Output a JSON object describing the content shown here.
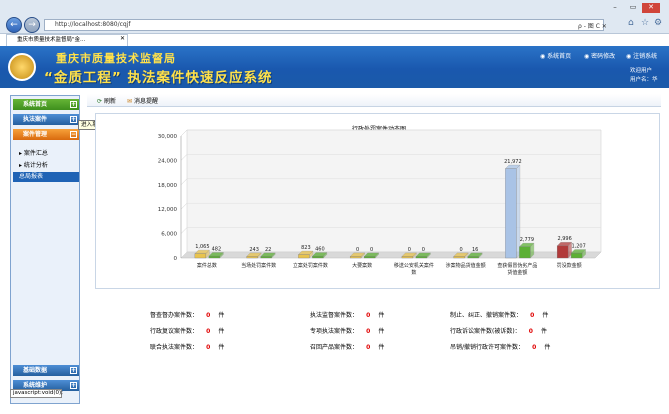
{
  "browser": {
    "back": "←",
    "forward": "→",
    "url": "http://localhost:8080/cqjf",
    "search_hint": "ρ - 图 C ✕",
    "tab_title": "重庆市质量技术监督局\"金...",
    "tab_close": "✕",
    "home": "⌂",
    "star": "☆",
    "gear": "⚙"
  },
  "header": {
    "title_line1": "重庆市质量技术监督局",
    "title_line2": "“金质工程” 执法案件快速反应系统",
    "links": [
      "系统首页",
      "密码修改",
      "注销系统"
    ],
    "welcome_line1": "欢迎用户",
    "welcome_line2": "用户名：华"
  },
  "sidebar": {
    "home": "系统首页",
    "enforce": "执法案件",
    "case_mgmt": "案件管理",
    "sub_items": [
      "案件汇总",
      "统计分析"
    ],
    "active_item": "总局报表",
    "basic_data": "基础数据",
    "system_maint": "系统维护",
    "plus": "+",
    "minus": "−"
  },
  "tooltip": "进入系统首页",
  "statusbar": "javascript:void(0);",
  "toolbar": {
    "refresh": "刷新",
    "notify": "消息提醒"
  },
  "chart_data": {
    "type": "bar",
    "title": "行政处罚案件动态图",
    "categories": [
      "案件总数",
      "当场处罚案件数",
      "立案处罚案件数",
      "大要案数",
      "移送公安机关案件数",
      "涉案物品货值金额",
      "查获假冒伪劣产品货值金额",
      "罚没款金额"
    ],
    "series": [
      {
        "values": [
          1065,
          243,
          823,
          0,
          0,
          0,
          21972,
          2996
        ],
        "color": "#e8c34e"
      },
      {
        "values": [
          482,
          22,
          460,
          0,
          0,
          16,
          2779,
          1207
        ],
        "color": "#5cb034"
      }
    ],
    "value_labels": [
      [
        "1,065",
        "243",
        "823",
        "0",
        "0",
        "0",
        "21,972",
        "2,996"
      ],
      [
        "482",
        "22",
        "460",
        "0",
        "0",
        "16",
        "2,779",
        "1,207"
      ]
    ],
    "special_colors": {
      "6_0": "#a9c3e6",
      "7_0": "#b13a3a"
    },
    "yticks": [
      "0",
      "6,000",
      "12,000",
      "18,000",
      "24,000",
      "30,000"
    ],
    "ylim": [
      0,
      30000
    ]
  },
  "stats": [
    {
      "label": "督查督办案件数：",
      "value": "0",
      "unit": "件"
    },
    {
      "label": "执法监督案件数：",
      "value": "0",
      "unit": "件"
    },
    {
      "label": "制止、纠正、撤销案件数：",
      "value": "0",
      "unit": "件"
    },
    {
      "label": "行政复议案件数：",
      "value": "0",
      "unit": "件"
    },
    {
      "label": "专项执法案件数：",
      "value": "0",
      "unit": "件"
    },
    {
      "label": "行政诉讼案件数(被诉数)：",
      "value": "0",
      "unit": "件"
    },
    {
      "label": "联合执法案件数：",
      "value": "0",
      "unit": "件"
    },
    {
      "label": "召回产品案件数：",
      "value": "0",
      "unit": "件"
    },
    {
      "label": "吊销/撤销行政许可案件数：",
      "value": "0",
      "unit": "件"
    }
  ]
}
